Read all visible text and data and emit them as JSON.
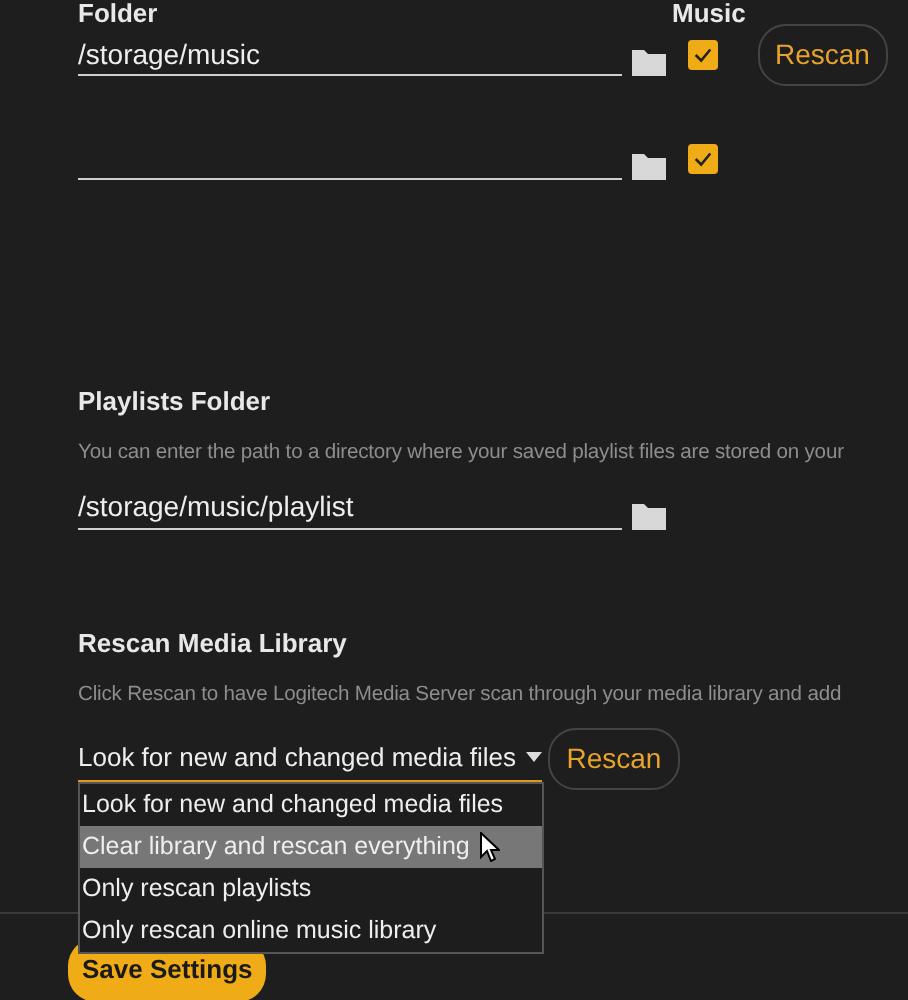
{
  "media_folders": {
    "columns": [
      "Folder",
      "Music"
    ],
    "rows": [
      {
        "path": "/storage/music",
        "music": true,
        "rescan_button": "Rescan"
      },
      {
        "music": true
      }
    ]
  },
  "playlists": {
    "title": "Playlists Folder",
    "description": "You can enter the path to a directory where your saved playlist files are stored on your",
    "path": "/storage/music/playlist"
  },
  "rescan": {
    "title": "Rescan Media Library",
    "description": "Click Rescan to have Logitech Media Server scan through your media library and add",
    "select": {
      "value": "Look for new and changed media files",
      "expanded": true,
      "options": [
        {
          "label": "Look for new and changed media files",
          "highlighted": false
        },
        {
          "label": "Clear library and rescan everything",
          "highlighted": true
        },
        {
          "label": "Only rescan playlists",
          "highlighted": false
        },
        {
          "label": "Only rescan online music library",
          "highlighted": false
        }
      ]
    },
    "button": "Rescan"
  },
  "save_button": "Save Settings"
}
